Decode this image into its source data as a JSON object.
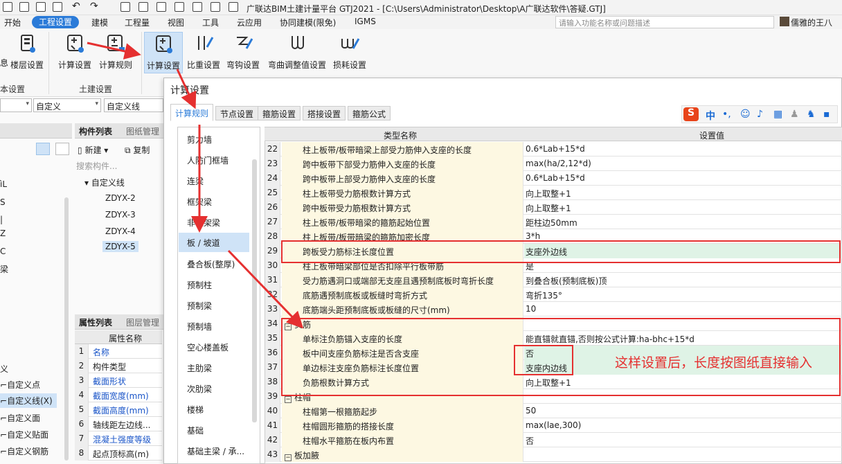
{
  "window": {
    "title": "广联达BIM土建计量平台 GTJ2021 - [C:\\Users\\Administrator\\Desktop\\A广联达软件\\答疑.GTJ]"
  },
  "menubar": {
    "items": [
      "开始",
      "工程设置",
      "建模",
      "工程量",
      "视图",
      "工具",
      "云应用",
      "协同建模(限免)",
      "IGMS"
    ],
    "active": "工程设置",
    "search_placeholder": "请输入功能名称或问题描述",
    "user": "儒雅的王八"
  },
  "ribbon": {
    "buttons": [
      {
        "label": "息"
      },
      {
        "label": "楼层设置"
      },
      {
        "label": "计算设置"
      },
      {
        "label": "计算规则"
      },
      {
        "label": "计算设置"
      },
      {
        "label": "比重设置"
      },
      {
        "label": "弯钩设置"
      },
      {
        "label": "弯曲调整值设置"
      },
      {
        "label": "损耗设置"
      }
    ],
    "group_labels": [
      "本设置",
      "土建设置"
    ]
  },
  "left": {
    "combos": [
      "",
      "自定义",
      "自定义线"
    ],
    "component_list_title": "构件列表",
    "drawing_mgmt": "图纸管理",
    "new_label": "新建",
    "copy_label": "复制",
    "search_placeholder": "搜索构件...",
    "tree_root": "自定义线",
    "tree_items": [
      "ZDYX-2",
      "ZDYX-3",
      "ZDYX-4",
      "ZDYX-5"
    ],
    "selected_item": "ZDYX-5",
    "prop_list_title": "属性列表",
    "layer_mgmt": "图层管理",
    "prop_header": "属性名称",
    "props": [
      {
        "n": "1",
        "v": "名称",
        "blue": true
      },
      {
        "n": "2",
        "v": "构件类型",
        "blue": false
      },
      {
        "n": "3",
        "v": "截面形状",
        "blue": true
      },
      {
        "n": "4",
        "v": "截面宽度(mm)",
        "blue": true
      },
      {
        "n": "5",
        "v": "截面高度(mm)",
        "blue": true
      },
      {
        "n": "6",
        "v": "轴线距左边线...",
        "blue": false
      },
      {
        "n": "7",
        "v": "混凝土强度等级",
        "blue": true
      },
      {
        "n": "8",
        "v": "起点顶标高(m)",
        "blue": false
      }
    ],
    "far_left_items": [
      "ìL",
      "S",
      "|",
      "Z",
      "C",
      "梁",
      "义",
      "自定义点",
      "自定义线(X)",
      "自定义面",
      "自定义贴面",
      "自定义钢筋"
    ]
  },
  "dialog": {
    "title": "计算设置",
    "tabs": [
      "计算规则",
      "节点设置",
      "箍筋设置",
      "搭接设置",
      "箍筋公式"
    ],
    "active_tab": "计算规则",
    "categories": [
      "剪力墙",
      "人防门框墙",
      "连梁",
      "框架梁",
      "非框架梁",
      "板 / 坡道",
      "叠合板(整厚)",
      "预制柱",
      "预制梁",
      "预制墙",
      "空心楼盖板",
      "主肋梁",
      "次肋梁",
      "楼梯",
      "基础",
      "基础主梁 / 承..."
    ],
    "selected_category": "板 / 坡道",
    "grid_headers": [
      "类型名称",
      "设置值"
    ],
    "rows": [
      {
        "n": "22",
        "name": "柱上板带/板带暗梁上部受力筋伸入支座的长度",
        "val": "0.6*Lab+15*d"
      },
      {
        "n": "23",
        "name": "跨中板带下部受力筋伸入支座的长度",
        "val": "max(ha/2,12*d)"
      },
      {
        "n": "24",
        "name": "跨中板带上部受力筋伸入支座的长度",
        "val": "0.6*Lab+15*d"
      },
      {
        "n": "25",
        "name": "柱上板带受力筋根数计算方式",
        "val": "向上取整+1"
      },
      {
        "n": "26",
        "name": "跨中板带受力筋根数计算方式",
        "val": "向上取整+1"
      },
      {
        "n": "27",
        "name": "柱上板带/板带暗梁的箍筋起始位置",
        "val": "距柱边50mm"
      },
      {
        "n": "28",
        "name": "柱上板带/板带暗梁的箍筋加密长度",
        "val": "3*h"
      },
      {
        "n": "29",
        "name": "跨板受力筋标注长度位置",
        "val": "支座外边线",
        "green": true
      },
      {
        "n": "30",
        "name": "柱上板带暗梁部位是否扣除平行板带筋",
        "val": "是"
      },
      {
        "n": "31",
        "name": "受力筋遇洞口或端部无支座且遇预制底板时弯折长度",
        "val": "到叠合板(预制底板)顶"
      },
      {
        "n": "32",
        "name": "底筋遇预制底板或板缝时弯折方式",
        "val": "弯折135°"
      },
      {
        "n": "33",
        "name": "底筋端头距预制底板或板缝的尺寸(mm)",
        "val": "10"
      },
      {
        "n": "34",
        "name": "负筋",
        "val": "",
        "group": true
      },
      {
        "n": "35",
        "name": "单标注负筋锚入支座的长度",
        "val": "能直锚就直锚,否则按公式计算:ha-bhc+15*d"
      },
      {
        "n": "36",
        "name": "板中间支座负筋标注是否含支座",
        "val": "否",
        "green": true
      },
      {
        "n": "37",
        "name": "单边标注支座负筋标注长度位置",
        "val": "支座内边线",
        "green": true
      },
      {
        "n": "38",
        "name": "负筋根数计算方式",
        "val": "向上取整+1"
      },
      {
        "n": "39",
        "name": "柱帽",
        "val": "",
        "group": true
      },
      {
        "n": "40",
        "name": "柱帽第一根箍筋起步",
        "val": "50"
      },
      {
        "n": "41",
        "name": "柱帽圆形箍筋的搭接长度",
        "val": "max(lae,300)"
      },
      {
        "n": "42",
        "name": "柱帽水平箍筋在板内布置",
        "val": "否"
      },
      {
        "n": "43",
        "name": "板加腋",
        "val": "",
        "group": true
      }
    ]
  },
  "annotation": "这样设置后，长度按图纸直接输入",
  "ime": {
    "label": "中"
  },
  "colors": {
    "accent": "#2b7bd8",
    "highlight": "#e53030",
    "green_row": "#dff3e6",
    "name_cell": "#fdf8e2"
  }
}
